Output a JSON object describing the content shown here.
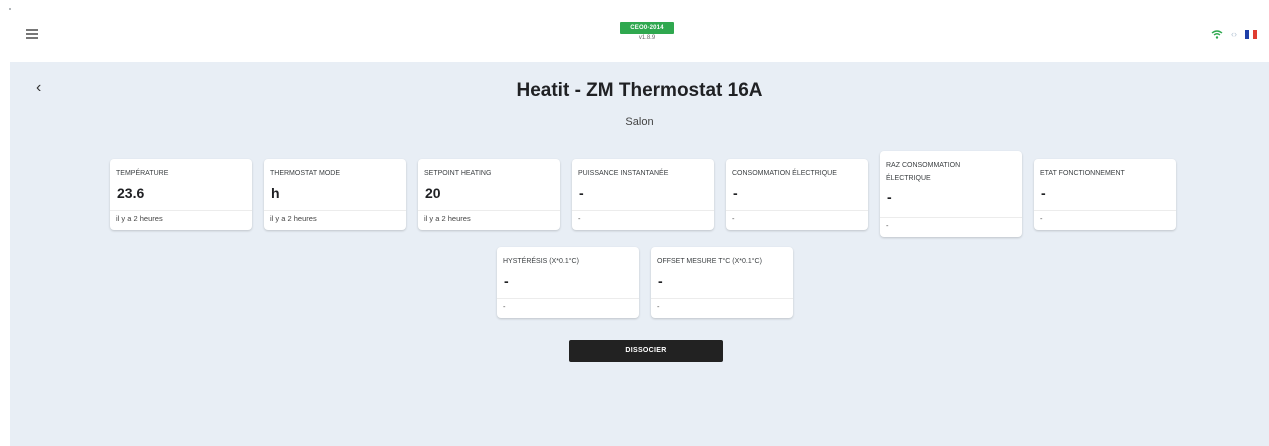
{
  "header": {
    "badge": "CEO0-2014",
    "version": "v1.8.9",
    "icons": [
      "menu-icon",
      "wifi-icon",
      "sync-icon",
      "french-flag-icon"
    ],
    "wifi_color": "#2fa84f",
    "flag_colors": [
      "#1f3fa8",
      "#ffffff",
      "#e03c31"
    ]
  },
  "page": {
    "back_symbol": "‹",
    "title": "Heatit - ZM Thermostat 16A",
    "room": "Salon"
  },
  "cards": [
    {
      "label": "TEMPÉRATURE",
      "value": "23.6",
      "time": "il y a 2 heures"
    },
    {
      "label": "THERMOSTAT MODE",
      "value": "h",
      "time": "il y a 2 heures"
    },
    {
      "label": "SETPOINT HEATING",
      "value": "20",
      "time": "il y a 2 heures"
    },
    {
      "label": "PUISSANCE INSTANTANÉE",
      "value": "-",
      "time": "-"
    },
    {
      "label": "CONSOMMATION ÉLECTRIQUE",
      "value": "-",
      "time": "-"
    },
    {
      "label": "RAZ CONSOMMATION ÉLECTRIQUE",
      "value": "-",
      "time": "-"
    },
    {
      "label": "ETAT FONCTIONNEMENT",
      "value": "-",
      "time": "-"
    },
    {
      "label": "HYSTÉRÉSIS (X*0.1°C)",
      "value": "-",
      "time": "-"
    },
    {
      "label": "OFFSET MESURE T°C (X*0.1°C)",
      "value": "-",
      "time": "-"
    }
  ],
  "actions": {
    "dissociate_label": "DISSOCIER"
  }
}
